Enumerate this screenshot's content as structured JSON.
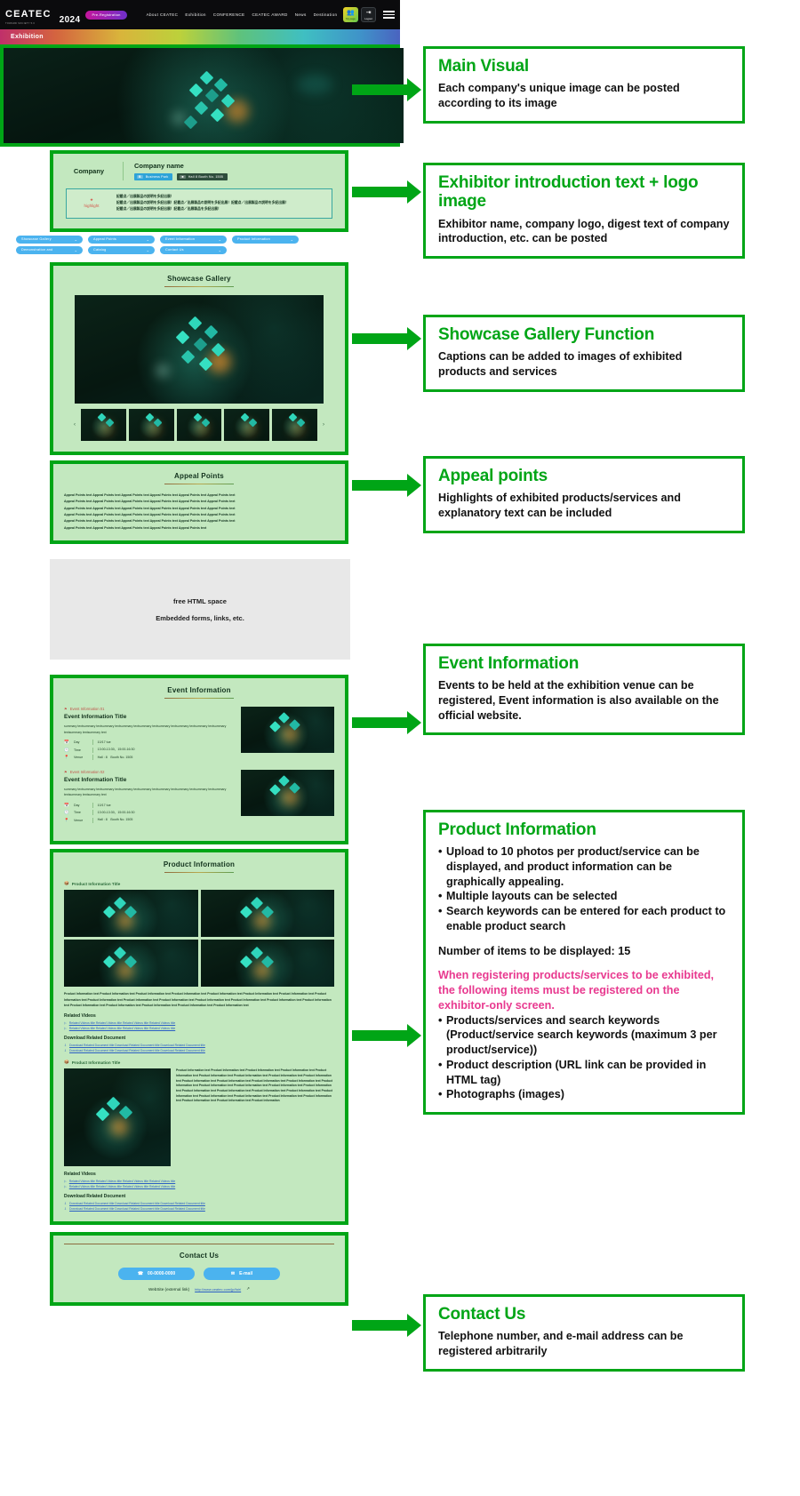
{
  "header": {
    "logo": "CEATEC",
    "logo_sub": "TOWARD SOCIETY 5.0",
    "year": "2024",
    "prereg": "Pre-Registration",
    "nav": [
      "About CEATEC",
      "Exhibition",
      "CONFERENCE",
      "CEATEC AWARD",
      "News",
      "Destination"
    ],
    "mypage_label": "My page",
    "login_label": "Logout",
    "mypage_icon": "people-icon",
    "login_icon": "logout-icon",
    "menu_icon": "hamburger-menu-icon"
  },
  "breadcrumb": {
    "label": "Exhibition"
  },
  "company": {
    "label": "Company",
    "name": "Company name",
    "tags": [
      {
        "badge": "B",
        "text": "Business Park"
      },
      {
        "badge": "■",
        "text": "Hall 8  Booth No. 1505"
      }
    ],
    "highlight_tag_icon": "highlight-icon",
    "highlight_tag": "highlight",
    "highlight_lines": [
      "記載点／出展製品の説明を多記出展！",
      "記載点／出展製品の説明を多記出展！記載点／出展製品の説明を多記出展！記載点／出展製品の説明を多記出展！",
      "記載点／出展製品の説明を多記出展！記載点／出展製品を多記出展！"
    ]
  },
  "anchors": {
    "row1": [
      "Showcase Gallery",
      "Appeal Points",
      "Event Information",
      "Product Information"
    ],
    "row2": [
      "Demonstration and",
      "Catalog",
      "Contact Us"
    ],
    "chevron": "⌄"
  },
  "showcase": {
    "title": "Showcase Gallery",
    "prev_arrow": "‹",
    "next_arrow": "›"
  },
  "appeal": {
    "title": "Appeal Points",
    "lines": [
      "Appeal Points text Appeal Points text Appeal Points text Appeal Points text Appeal Points text Appeal Points text",
      "Appeal Points text Appeal Points text Appeal Points text Appeal Points text Appeal Points text Appeal Points text",
      "Appeal Points text Appeal Points text Appeal Points text Appeal Points text Appeal Points text Appeal Points text",
      "Appeal Points text Appeal Points text Appeal Points text Appeal Points text Appeal Points text Appeal Points text",
      "Appeal Points text Appeal Points text Appeal Points text Appeal Points text Appeal Points text Appeal Points text",
      "Appeal Points text Appeal Points text Appeal Points text Appeal Points text Appeal Points text"
    ]
  },
  "freehtml": {
    "line1": "free HTML space",
    "line2": "Embedded forms, links, etc."
  },
  "events": {
    "title": "Event Information",
    "items": [
      {
        "kicker": "Event Information 01",
        "kicker_icon": "flag-icon",
        "title": "Event Information Title",
        "summary": "summary textsummary textsummary textsummary textsummary textsummary textsummary textsummary textsummary textsummary textsummary text",
        "day_icon": "calendar-icon",
        "day_key": "Day",
        "day_val": "10/17 tue",
        "time_icon": "clock-icon",
        "time_key": "Time",
        "time_val": "13:00-13:30、15:00-16:30",
        "venue_icon": "pin-icon",
        "venue_key": "Venue",
        "venue_val": "Hall : 8　Booth No. 1505"
      },
      {
        "kicker": "Event Information 02",
        "kicker_icon": "flag-icon",
        "title": "Event Information Title",
        "summary": "summary textsummary textsummary textsummary textsummary textsummary textsummary textsummary textsummary textsummary textsummary text",
        "day_icon": "calendar-icon",
        "day_key": "Day",
        "day_val": "10/17 tue",
        "time_icon": "clock-icon",
        "time_key": "Time",
        "time_val": "13:00-13:30、15:00-16:30",
        "venue_icon": "pin-icon",
        "venue_key": "Venue",
        "venue_val": "Hall : 8　Booth No. 1505"
      }
    ]
  },
  "products": {
    "title": "Product Information",
    "item1": {
      "kicker": "Product Information Title",
      "kicker_icon": "box-icon",
      "body": "Product Information text Product Information text Product Information text Product Information text Product Information text Product Information text Product Information text Product Information text Product Information text Product Information text Product Information text Product Information text Product Information text Product Information text Product Information text Product Information text Product Information text Product Information text Product Information text Product Information text",
      "videos_head": "Related Videos",
      "videos": [
        "Related Videos title Related Videos title Related Videos title Related Videos title",
        "Related Videos title Related Videos title Related Videos title Related Videos title"
      ],
      "docs_head": "Download Related Document",
      "docs": [
        "Download Related Document title Download Related Document title Download Related Document title",
        "Download Related Document title Download Related Document title Download Related Document title"
      ]
    },
    "item2": {
      "kicker": "Product Information Title",
      "kicker_icon": "box-icon",
      "body": "Product Information text Product Information text Product Information text Product Information text Product Information text Product Information text Product Information text Product Information text Product Information text Product Information text Product Information text Product Information text Product Information text Product Information text Product Information text Product Information text Product Information text Product Information text Product Information text Product Information text Product Information text Product Information text Product Information text Product Information text Product Information text Product Information text Product Information text Product Information text Product Information text Product Information",
      "videos_head": "Related Videos",
      "videos": [
        "Related Videos title Related Videos title Related Videos title Related Videos title",
        "Related Videos title Related Videos title Related Videos title Related Videos title"
      ],
      "docs_head": "Download Related Document",
      "docs": [
        "Download Related Document title Download Related Document title Download Related Document title",
        "Download Related Document title Download Related Document title Download Related Document title"
      ]
    },
    "video_icon": "play-icon",
    "doc_icon": "download-icon"
  },
  "contact": {
    "title": "Contact Us",
    "phone_icon": "phone-icon",
    "phone_label": "00-0000-0000",
    "mail_icon": "mail-icon",
    "mail_label": "E-mail",
    "website_label": "WebSite (external link)",
    "website_url": "http://www.ceatec.com/jp/fair/",
    "external_icon": "external-link-icon"
  },
  "annotations": [
    {
      "title": "Main Visual",
      "paras": [
        "Each company's unique image can be posted according to its image"
      ]
    },
    {
      "title": "Exhibitor introduction text + logo image",
      "paras": [
        "Exhibitor name, company logo, digest text of company introduction, etc. can be posted"
      ]
    },
    {
      "title": "Showcase Gallery Function",
      "paras": [
        "Captions can be added to images of exhibited products and services"
      ]
    },
    {
      "title": "Appeal points",
      "paras": [
        "Highlights of exhibited products/services and explanatory text can be included"
      ]
    },
    {
      "title": "Event Information",
      "paras": [
        "Events to be held at the exhibition venue can be registered, Event information is also available on the official website."
      ]
    },
    {
      "title": "Product Information",
      "bullets": [
        "Upload to 10 photos per product/service can be displayed, and product information can be graphically appealing.",
        "Multiple layouts can be selected",
        "Search keywords can be entered for each product to enable product search"
      ],
      "count_line": "Number of items to be displayed: 15",
      "pink_note": "When registering products/services to be exhibited, the following items must be registered on the exhibitor-only screen.",
      "bullets2": [
        "Products/services and search keywords (Product/service search keywords (maximum 3 per product/service))",
        "Product description (URL link can be provided in HTML tag)",
        "Photographs (images)"
      ]
    },
    {
      "title": "Contact Us",
      "paras": [
        "Telephone number, and e-mail address can be registered arbitrarily"
      ]
    }
  ]
}
